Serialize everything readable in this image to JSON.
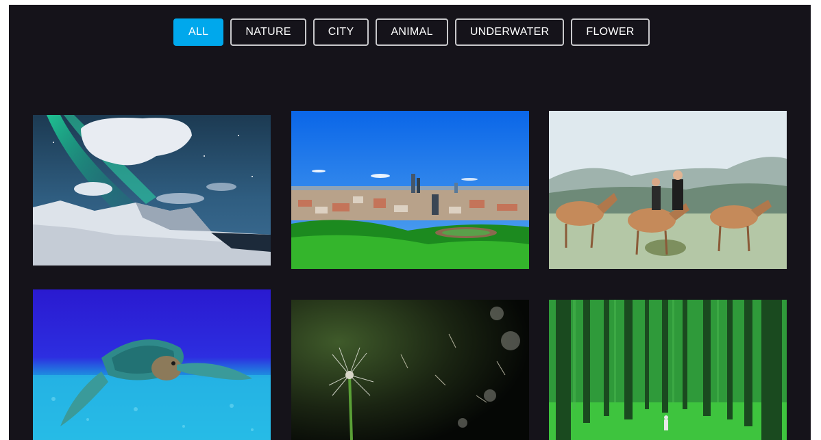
{
  "filters": {
    "items": [
      {
        "label": "ALL",
        "active": true
      },
      {
        "label": "NATURE",
        "active": false
      },
      {
        "label": "CITY",
        "active": false
      },
      {
        "label": "ANIMAL",
        "active": false
      },
      {
        "label": "UNDERWATER",
        "active": false
      },
      {
        "label": "FLOWER",
        "active": false
      }
    ]
  },
  "gallery": {
    "items": [
      {
        "subject": "aurora over snowy coast",
        "category": "nature"
      },
      {
        "subject": "city skyline with park",
        "category": "city"
      },
      {
        "subject": "deer with people in field",
        "category": "animal"
      },
      {
        "subject": "sea turtle swimming",
        "category": "underwater"
      },
      {
        "subject": "dandelion seeds blowing",
        "category": "flower"
      },
      {
        "subject": "green pine forest",
        "category": "nature"
      }
    ]
  },
  "colors": {
    "background": "#15131a",
    "accent": "#00a8ec",
    "button_border": "#c9c9cc",
    "text": "#ffffff"
  }
}
